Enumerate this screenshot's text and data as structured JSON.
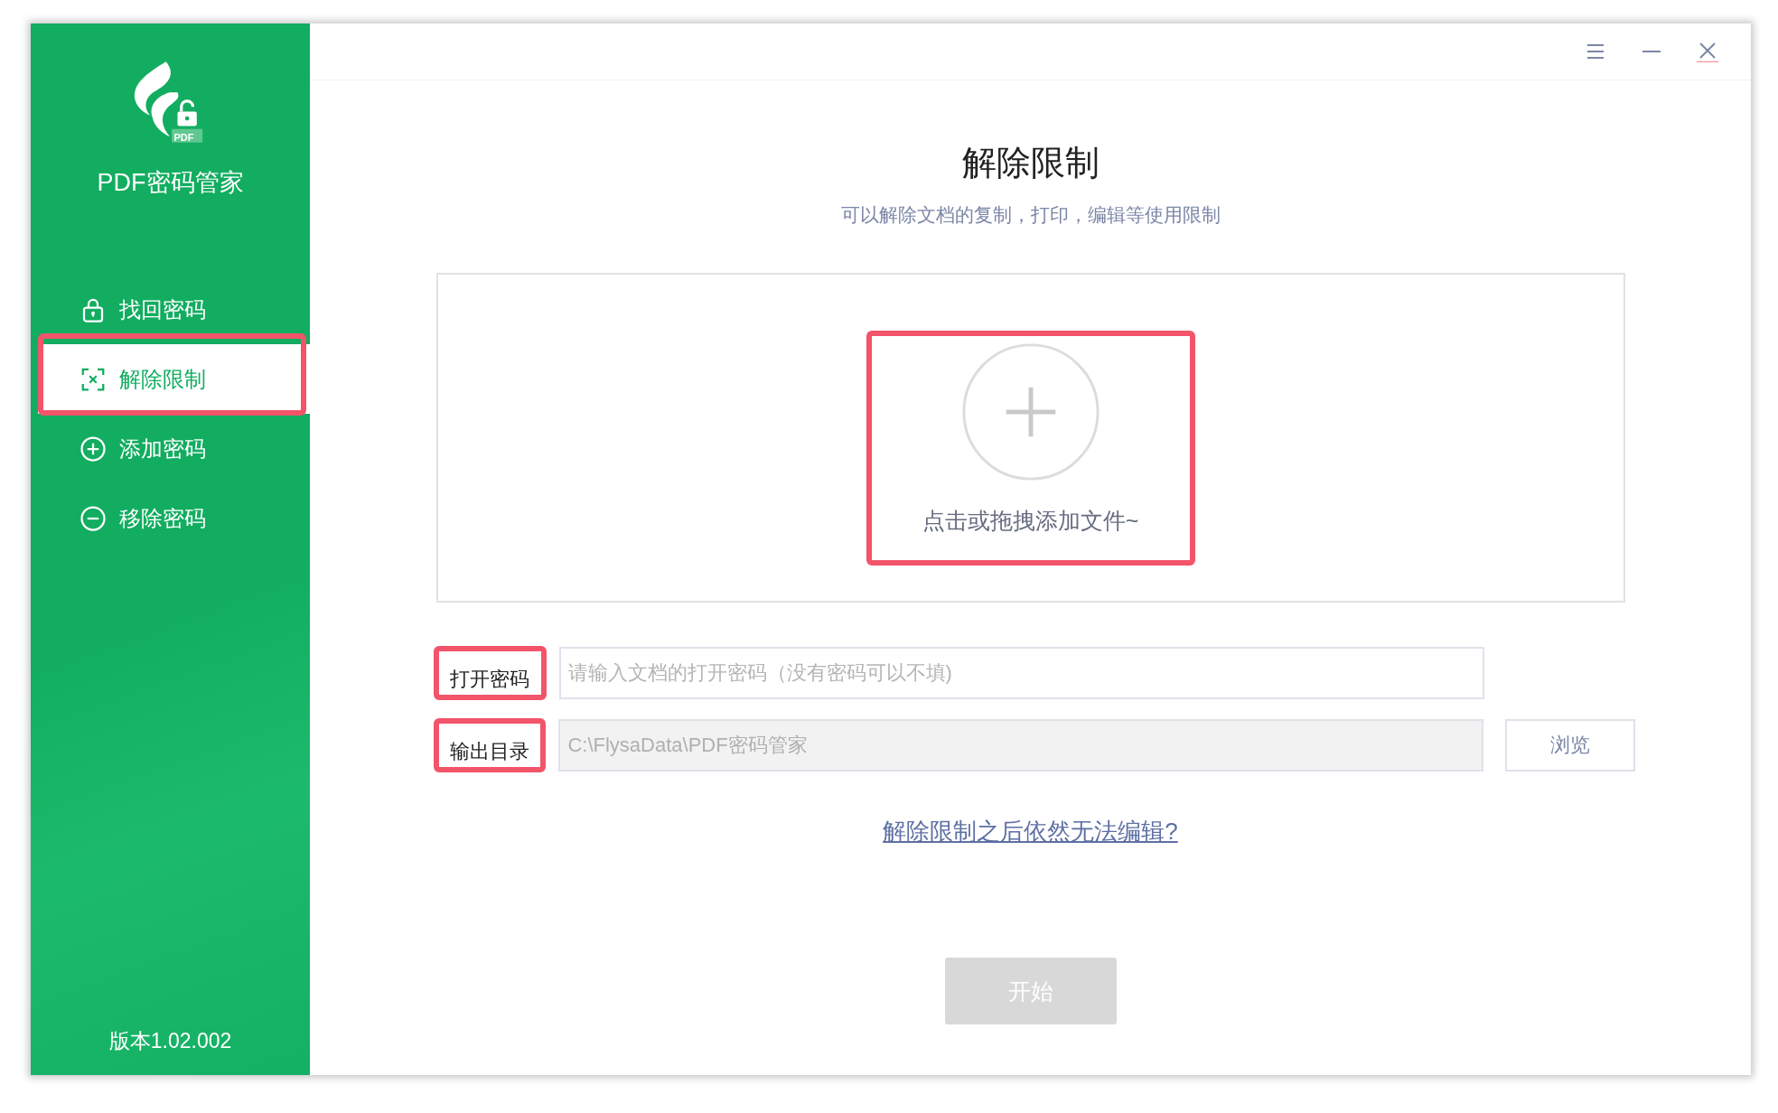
{
  "sidebar": {
    "logo_badge": "PDF",
    "app_name": "PDF密码管家",
    "nav_items": [
      {
        "label": "找回密码",
        "kind": "lock",
        "selected": false,
        "highlighted": false
      },
      {
        "label": "解除限制",
        "kind": "frame-x",
        "selected": true,
        "highlighted": true
      },
      {
        "label": "添加密码",
        "kind": "plus-circle",
        "selected": false,
        "highlighted": false
      },
      {
        "label": "移除密码",
        "kind": "minus-circle",
        "selected": false,
        "highlighted": false
      }
    ],
    "version": "版本1.02.002"
  },
  "main": {
    "title": "解除限制",
    "subtitle": "可以解除文档的复制，打印，编辑等使用限制",
    "drop_zone": {
      "label": "点击或拖拽添加文件~",
      "highlighted": true
    },
    "fields": [
      {
        "label": "打开密码",
        "kind": "input",
        "placeholder": "请输入文档的打开密码（没有密码可以不填)",
        "highlighted": true
      },
      {
        "label": "输出目录",
        "kind": "readonly",
        "value": "C:\\FlysaData\\PDF密码管家",
        "button": "浏览",
        "highlighted": true
      }
    ],
    "help_link": "解除限制之后依然无法编辑?",
    "start_button": {
      "label": "开始",
      "disabled": true
    }
  }
}
